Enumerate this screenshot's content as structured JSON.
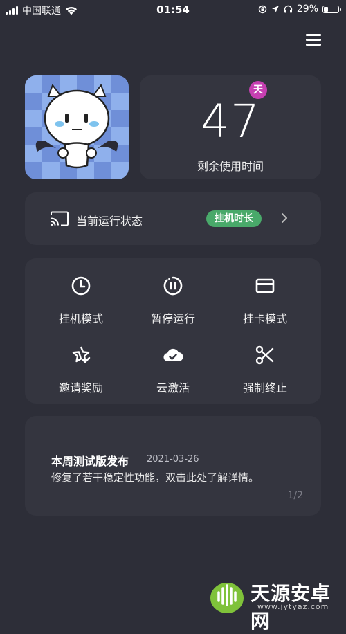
{
  "status_bar": {
    "carrier": "中国联通",
    "time": "01:54",
    "battery": "29%",
    "battery_level": 0.29,
    "icons": [
      "signal-icon",
      "wifi-icon",
      "rotation-lock-icon",
      "location-icon",
      "headphones-icon",
      "battery-icon"
    ]
  },
  "header": {
    "menu_icon": "hamburger-menu-icon"
  },
  "usage": {
    "unit_badge": "天",
    "remaining_value": "47",
    "remaining_label": "剩余使用时间"
  },
  "run_status": {
    "label": "当前运行状态",
    "badge": "挂机时长",
    "icon": "cast-icon",
    "badge_color": "#49a96a"
  },
  "actions": [
    {
      "label": "挂机模式",
      "icon": "clock-icon"
    },
    {
      "label": "暂停运行",
      "icon": "pause-icon"
    },
    {
      "label": "挂卡模式",
      "icon": "card-icon"
    },
    {
      "label": "邀请奖励",
      "icon": "star-check-icon"
    },
    {
      "label": "云激活",
      "icon": "cloud-check-icon"
    },
    {
      "label": "强制终止",
      "icon": "scissors-icon"
    }
  ],
  "news": {
    "title": "本周测试版发布",
    "date": "2021-03-26",
    "body": "修复了若干稳定性功能，双击此处了解详情。",
    "page": "1/2"
  },
  "watermark": {
    "text": "天源安卓网",
    "url": "www.jytyaz.com"
  },
  "colors": {
    "background": "#2d2e38",
    "card": "#34353f",
    "badge_magenta": "#c63fb1",
    "badge_green": "#49a96a"
  }
}
